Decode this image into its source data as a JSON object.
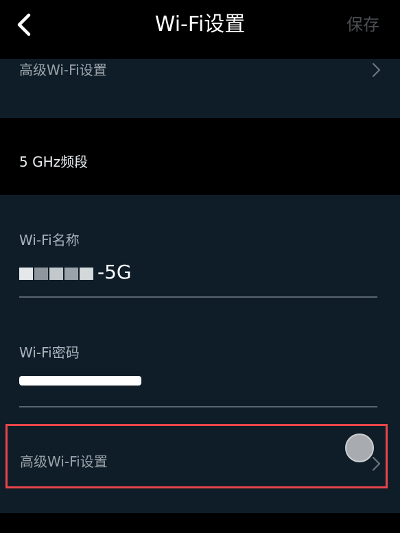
{
  "header": {
    "back_icon": "chevron-left-icon",
    "title": "Wi-Fi设置",
    "save_label": "保存"
  },
  "top_card": {
    "label": "高级Wi-Fi设置",
    "chevron_icon": "chevron-right-icon"
  },
  "section": {
    "title": "5 GHz频段"
  },
  "wifi_name": {
    "label": "Wi-Fi名称",
    "value_suffix": "-5G"
  },
  "wifi_password": {
    "label": "Wi-Fi密码"
  },
  "advanced_row": {
    "label": "高级Wi-Fi设置",
    "chevron_icon": "chevron-right-icon"
  },
  "colors": {
    "background": "#000000",
    "card": "#0e1d28",
    "highlight": "#e8454b",
    "save_disabled": "#4a4d52"
  }
}
